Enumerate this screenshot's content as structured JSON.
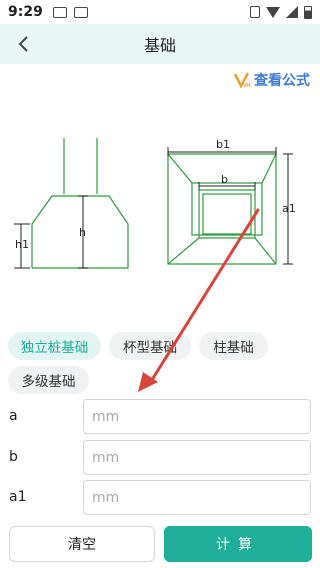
{
  "status_bar": {
    "time": "9:29"
  },
  "header": {
    "title": "基础"
  },
  "formula_link": {
    "label": "查看公式"
  },
  "diagram": {
    "left_labels": {
      "h1": "h1",
      "h": "h"
    },
    "right_labels": {
      "b1": "b1",
      "b": "b",
      "a1": "a1"
    }
  },
  "types": [
    {
      "label": "独立桩基础",
      "active": true
    },
    {
      "label": "杯型基础",
      "active": false
    },
    {
      "label": "柱基础",
      "active": false
    },
    {
      "label": "多级基础",
      "active": false
    }
  ],
  "fields": [
    {
      "label": "a",
      "value": "",
      "placeholder": "mm"
    },
    {
      "label": "b",
      "value": "",
      "placeholder": "mm"
    },
    {
      "label": "a1",
      "value": "",
      "placeholder": "mm"
    }
  ],
  "actions": {
    "clear_label": "清空",
    "calc_label": "计算"
  },
  "colors": {
    "accent": "#1fae97",
    "header_bg": "#e9f7f6",
    "diagram_line": "#2e9b3f",
    "link": "#3f7ad8",
    "annotation_arrow": "#d9453a"
  }
}
